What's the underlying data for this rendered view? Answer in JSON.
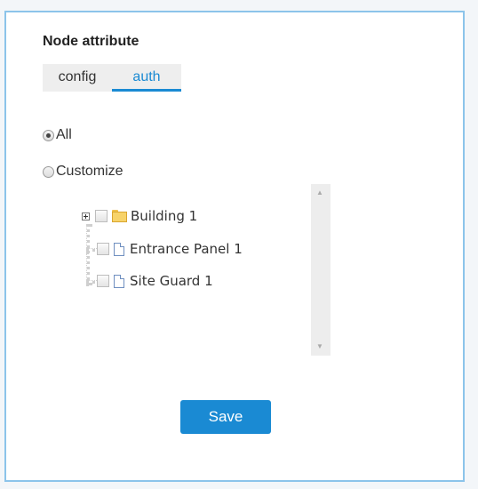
{
  "panel": {
    "title": "Node attribute",
    "tabs": [
      {
        "label": "config",
        "active": false
      },
      {
        "label": "auth",
        "active": true
      }
    ],
    "scope_options": [
      {
        "label": "All",
        "checked": true
      },
      {
        "label": "Customize",
        "checked": false
      }
    ],
    "tree": [
      {
        "label": "Building 1",
        "type": "folder",
        "expandable": true,
        "checked": false
      },
      {
        "label": "Entrance Panel 1",
        "type": "file",
        "expandable": false,
        "checked": false
      },
      {
        "label": "Site Guard 1",
        "type": "file",
        "expandable": false,
        "checked": false
      }
    ],
    "save_label": "Save"
  },
  "colors": {
    "accent": "#1a8ad3",
    "panel_border": "#8cc4ea"
  },
  "icons": {
    "expand": "plus-square-icon",
    "folder": "folder-icon",
    "file": "document-icon",
    "scroll_up": "triangle-up-icon",
    "scroll_down": "triangle-down-icon"
  }
}
